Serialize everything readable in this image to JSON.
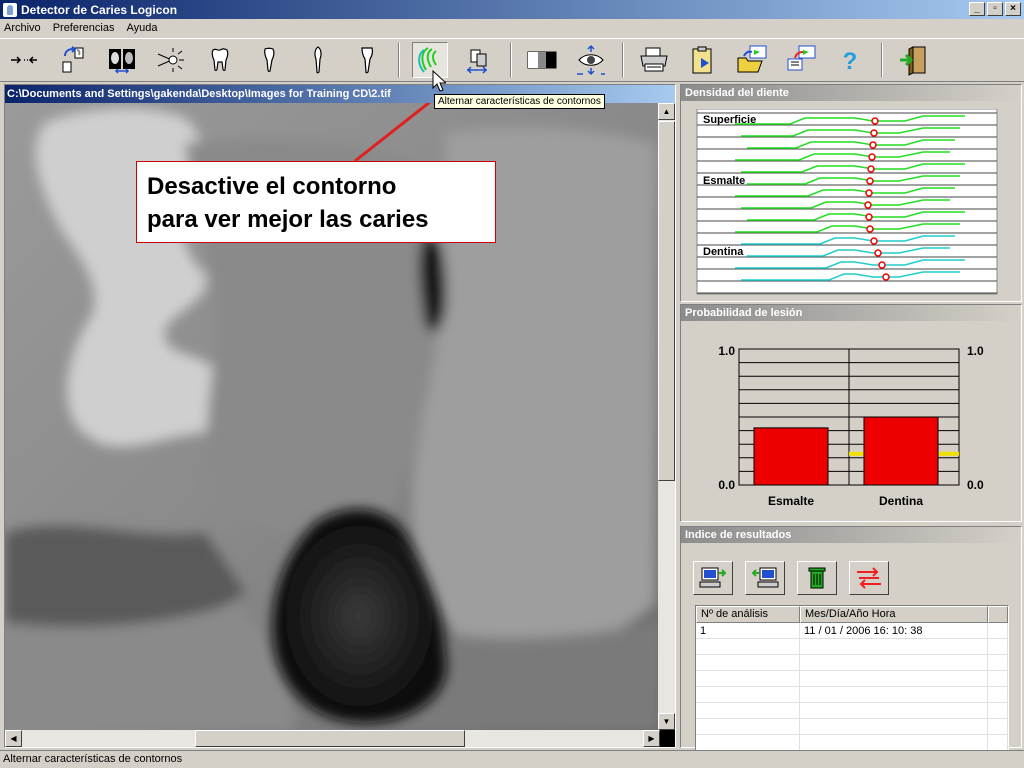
{
  "window": {
    "title": "Detector de Caries Logicon",
    "controls": [
      "_",
      "▫",
      "×"
    ]
  },
  "menu": [
    "Archivo",
    "Preferencias",
    "Ayuda"
  ],
  "toolbar": {
    "tooltip": "Alternar características de contornos"
  },
  "image_panel": {
    "path": "C:\\Documents and Settings\\gakenda\\Desktop\\Images for Training CD\\2.tif"
  },
  "callout": {
    "line1": "Desactive el contorno",
    "line2": "para ver mejor las caries",
    "border_color": "#d00000"
  },
  "density_panel": {
    "title": "Densidad del diente",
    "labels": [
      "Superficie",
      "Esmalte",
      "Dentina"
    ],
    "enamel_color": "#22dd22",
    "dentin_color": "#22cccc",
    "marker_color": "#ee0000"
  },
  "probability_panel": {
    "title": "Probabilidad de lesión",
    "axis_top_left": "1.0",
    "axis_bottom_left": "0.0",
    "axis_top_right": "1.0",
    "axis_bottom_right": "0.0",
    "chart_data": {
      "type": "bar",
      "categories": [
        "Esmalte",
        "Dentina"
      ],
      "values": [
        0.42,
        0.5
      ],
      "threshold": 0.23,
      "ylim": [
        0,
        1
      ],
      "bar_color": "#ee0000",
      "threshold_color": "#f0e000"
    }
  },
  "results_panel": {
    "title": "Indice de resultados",
    "columns": [
      "Nº de análisis",
      "Mes/Día/Año  Hora",
      ""
    ],
    "rows": [
      [
        "1",
        "11 / 01 / 2006   16: 10: 38"
      ]
    ]
  },
  "status": "Alternar características de contornos"
}
